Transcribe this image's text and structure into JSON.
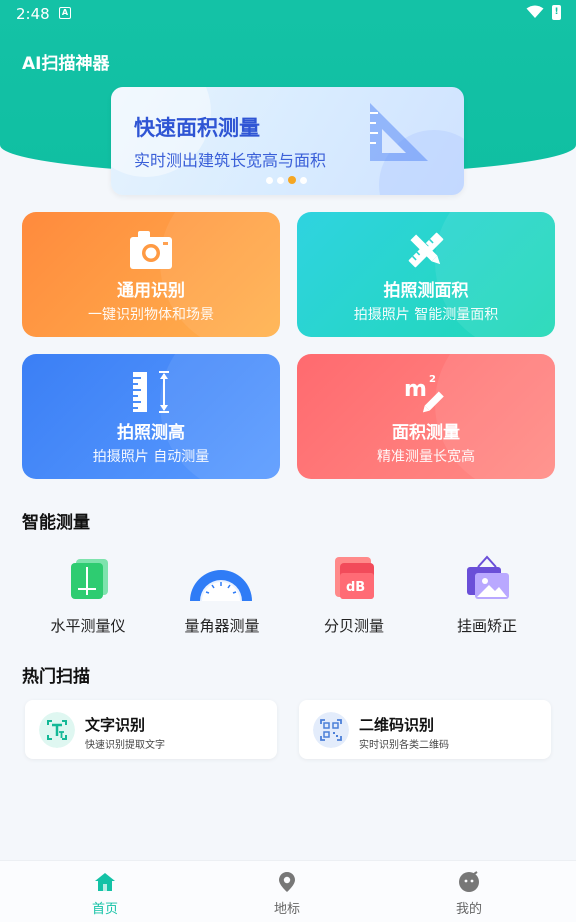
{
  "status": {
    "time": "2:48",
    "a_badge": "A",
    "battery": "!"
  },
  "app": {
    "title": "AI扫描神器"
  },
  "banner": {
    "title": "快速面积测量",
    "subtitle": "实时测出建筑长宽高与面积",
    "icon": "ruler-triangle-icon",
    "dots": 4,
    "active_dot": 2
  },
  "cards": [
    {
      "title": "通用识别",
      "subtitle": "一键识别物体和场景",
      "icon": "camera-icon",
      "color": "#ff8a3d"
    },
    {
      "title": "拍照测面积",
      "subtitle": "拍摄照片 智能测量面积",
      "icon": "ruler-pencil-icon",
      "color": "#2fd3e0"
    },
    {
      "title": "拍照测高",
      "subtitle": "拍摄照片 自动测量",
      "icon": "height-ruler-icon",
      "color": "#3b7ff5"
    },
    {
      "title": "面积测量",
      "subtitle": "精准测量长宽高",
      "icon": "square-meter-icon",
      "color": "#ff6a6f"
    }
  ],
  "smart": {
    "title": "智能测量",
    "tools": [
      {
        "label": "水平测量仪",
        "icon": "level-icon"
      },
      {
        "label": "量角器测量",
        "icon": "protractor-icon"
      },
      {
        "label": "分贝测量",
        "icon": "decibel-icon"
      },
      {
        "label": "挂画矫正",
        "icon": "picture-frame-icon"
      }
    ]
  },
  "hot": {
    "title": "热门扫描",
    "items": [
      {
        "title": "文字识别",
        "subtitle": "快速识别提取文字",
        "icon": "text-scan-icon"
      },
      {
        "title": "二维码识别",
        "subtitle": "实时识别各类二维码",
        "icon": "qrcode-scan-icon"
      }
    ]
  },
  "nav": [
    {
      "label": "首页",
      "icon": "home-icon",
      "active": true
    },
    {
      "label": "地标",
      "icon": "location-pin-icon",
      "active": false
    },
    {
      "label": "我的",
      "icon": "profile-icon",
      "active": false
    }
  ],
  "colors": {
    "accent": "#14c2a6",
    "banner_text": "#2f55d4"
  }
}
